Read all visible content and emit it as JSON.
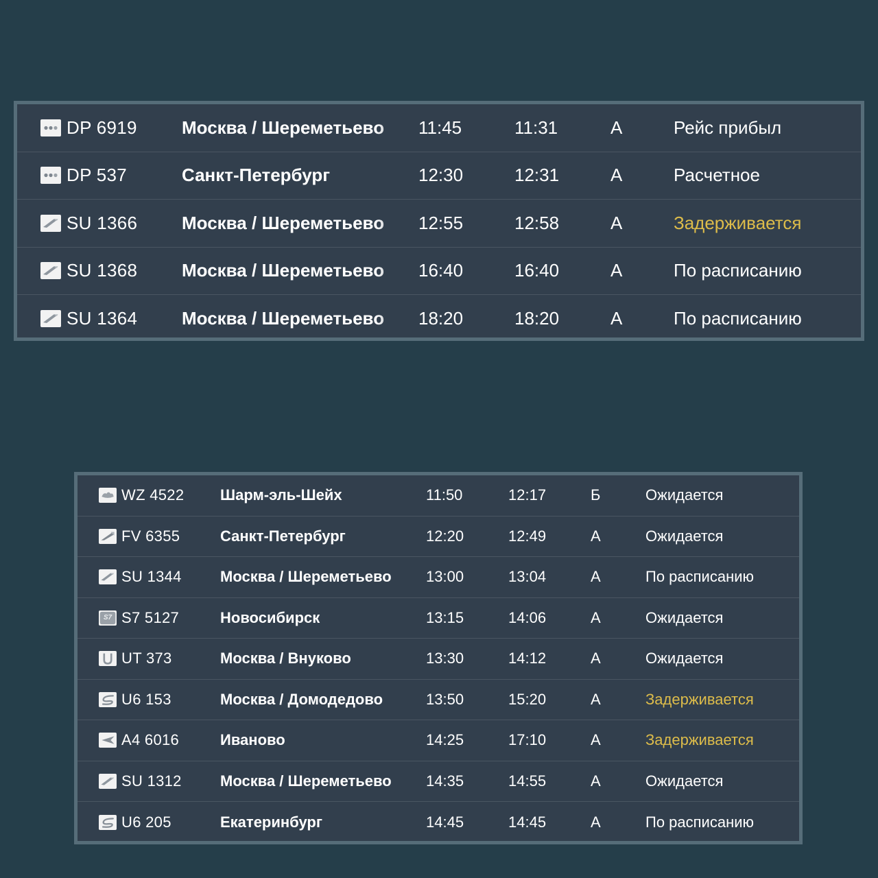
{
  "theme": {
    "page_background": "#253e4a",
    "board_frame": "#566d79",
    "row_background": "#323f4d",
    "row_divider": "#4a5662",
    "text_primary": "#ffffff",
    "status_delayed_color": "#ddbc4a"
  },
  "boards": [
    {
      "id": "arrivals-board-top",
      "rows": [
        {
          "logo": "pobeda-dots-icon",
          "flight": "DP 6919",
          "destination": "Москва / Шереметьево",
          "scheduled": "11:45",
          "estimated": "11:31",
          "terminal": "А",
          "status": "Рейс прибыл",
          "status_state": "normal"
        },
        {
          "logo": "pobeda-dots-icon",
          "flight": "DP 537",
          "destination": "Санкт-Петербург",
          "scheduled": "12:30",
          "estimated": "12:31",
          "terminal": "А",
          "status": "Расчетное",
          "status_state": "normal"
        },
        {
          "logo": "aeroflot-icon",
          "flight": "SU 1366",
          "destination": "Москва / Шереметьево",
          "scheduled": "12:55",
          "estimated": "12:58",
          "terminal": "А",
          "status": "Задерживается",
          "status_state": "delayed"
        },
        {
          "logo": "aeroflot-icon",
          "flight": "SU 1368",
          "destination": "Москва / Шереметьево",
          "scheduled": "16:40",
          "estimated": "16:40",
          "terminal": "А",
          "status": "По расписанию",
          "status_state": "normal"
        },
        {
          "logo": "aeroflot-icon",
          "flight": "SU 1364",
          "destination": "Москва / Шереметьево",
          "scheduled": "18:20",
          "estimated": "18:20",
          "terminal": "А",
          "status": "По расписанию",
          "status_state": "normal"
        }
      ]
    },
    {
      "id": "arrivals-board-bottom",
      "rows": [
        {
          "logo": "redwings-icon",
          "flight": "WZ 4522",
          "destination": "Шарм-эль-Шейх",
          "scheduled": "11:50",
          "estimated": "12:17",
          "terminal": "Б",
          "status": "Ожидается",
          "status_state": "normal"
        },
        {
          "logo": "rossiya-icon",
          "flight": "FV 6355",
          "destination": "Санкт-Петербург",
          "scheduled": "12:20",
          "estimated": "12:49",
          "terminal": "А",
          "status": "Ожидается",
          "status_state": "normal"
        },
        {
          "logo": "aeroflot-icon",
          "flight": "SU 1344",
          "destination": "Москва / Шереметьево",
          "scheduled": "13:00",
          "estimated": "13:04",
          "terminal": "А",
          "status": "По расписанию",
          "status_state": "normal"
        },
        {
          "logo": "s7-icon",
          "flight": "S7 5127",
          "destination": "Новосибирск",
          "scheduled": "13:15",
          "estimated": "14:06",
          "terminal": "А",
          "status": "Ожидается",
          "status_state": "normal"
        },
        {
          "logo": "utair-icon",
          "flight": "UT 373",
          "destination": "Москва / Внуково",
          "scheduled": "13:30",
          "estimated": "14:12",
          "terminal": "А",
          "status": "Ожидается",
          "status_state": "normal"
        },
        {
          "logo": "uralairlines-icon",
          "flight": "U6 153",
          "destination": "Москва / Домодедово",
          "scheduled": "13:50",
          "estimated": "15:20",
          "terminal": "А",
          "status": "Задерживается",
          "status_state": "delayed"
        },
        {
          "logo": "azimuth-icon",
          "flight": "A4 6016",
          "destination": "Иваново",
          "scheduled": "14:25",
          "estimated": "17:10",
          "terminal": "А",
          "status": "Задерживается",
          "status_state": "delayed"
        },
        {
          "logo": "aeroflot-icon",
          "flight": "SU 1312",
          "destination": "Москва / Шереметьево",
          "scheduled": "14:35",
          "estimated": "14:55",
          "terminal": "А",
          "status": "Ожидается",
          "status_state": "normal"
        },
        {
          "logo": "uralairlines-icon",
          "flight": "U6 205",
          "destination": "Екатеринбург",
          "scheduled": "14:45",
          "estimated": "14:45",
          "terminal": "А",
          "status": "По расписанию",
          "status_state": "normal"
        }
      ]
    }
  ]
}
